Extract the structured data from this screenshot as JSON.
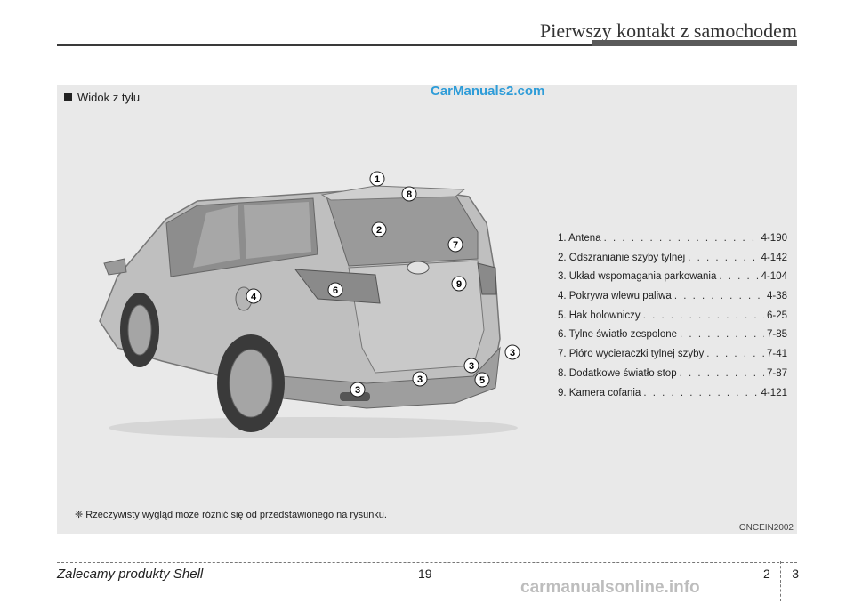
{
  "header": {
    "title": "Pierwszy kontakt z samochodem"
  },
  "section": {
    "title": "Widok z tyłu"
  },
  "watermark": "CarManuals2.com",
  "callouts": [
    "1",
    "2",
    "3",
    "4",
    "5",
    "6",
    "7",
    "8",
    "9"
  ],
  "legend": [
    {
      "label": "1. Antena",
      "page": "4-190"
    },
    {
      "label": "2. Odszranianie szyby tylnej",
      "page": "4-142"
    },
    {
      "label": "3. Układ wspomagania parkowania",
      "page": "4-104"
    },
    {
      "label": "4. Pokrywa wlewu paliwa",
      "page": "4-38"
    },
    {
      "label": "5. Hak holowniczy",
      "page": "6-25"
    },
    {
      "label": "6. Tylne światło zespolone",
      "page": "7-85"
    },
    {
      "label": "7. Pióro wycieraczki tylnej szyby",
      "page": "7-41"
    },
    {
      "label": "8. Dodatkowe światło stop",
      "page": "7-87"
    },
    {
      "label": "9. Kamera cofania",
      "page": "4-121"
    }
  ],
  "footnote": "❈ Rzeczywisty wygląd może różnić się od przedstawionego na rysunku.",
  "figure_code": "ONCEIN2002",
  "footer": {
    "left": "Zalecamy produkty Shell",
    "page": "19",
    "chapter": "2",
    "chapter_page": "3",
    "site": "carmanualsonline.info"
  }
}
